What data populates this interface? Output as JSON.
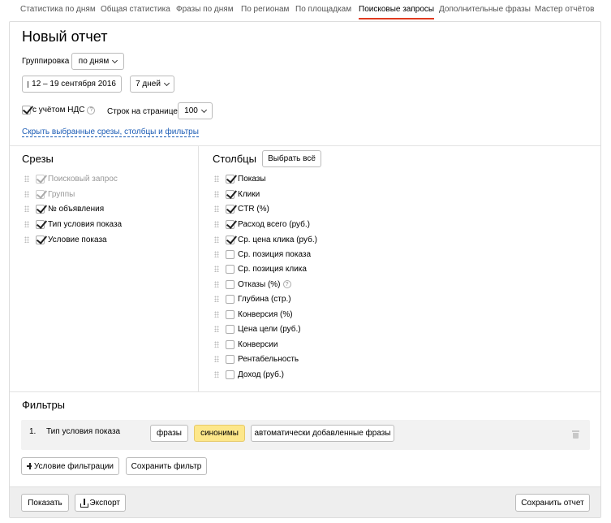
{
  "tabs": [
    {
      "label": "Статистика по дням",
      "active": false
    },
    {
      "label": "Общая статистика",
      "active": false
    },
    {
      "label": "Фразы по дням",
      "active": false
    },
    {
      "label": "По регионам",
      "active": false
    },
    {
      "label": "По площадкам",
      "active": false
    },
    {
      "label": "Поисковые запросы",
      "active": true
    },
    {
      "label": "Дополнительные фразы",
      "active": false
    },
    {
      "label": "Мастер отчётов",
      "active": false
    }
  ],
  "report": {
    "title": "Новый отчет",
    "grouping_label": "Группировка",
    "grouping_value": "по дням",
    "date_range": "12 – 19 сентября 2016",
    "period": "7 дней",
    "vat_label": "с учётом НДС",
    "vat_checked": true,
    "rows_label": "Строк на странице",
    "rows_value": "100",
    "hide_link": "Скрыть выбранные срезы, столбцы и фильтры"
  },
  "slices": {
    "title": "Срезы",
    "items": [
      {
        "label": "Поисковый запрос",
        "checked": true,
        "disabled": true
      },
      {
        "label": "Группы",
        "checked": true,
        "disabled": true
      },
      {
        "label": "№ объявления",
        "checked": true,
        "disabled": false
      },
      {
        "label": "Тип условия показа",
        "checked": true,
        "disabled": false
      },
      {
        "label": "Условие показа",
        "checked": true,
        "disabled": false
      }
    ]
  },
  "columns": {
    "title": "Столбцы",
    "select_all": "Выбрать всё",
    "items": [
      {
        "label": "Показы",
        "checked": true
      },
      {
        "label": "Клики",
        "checked": true
      },
      {
        "label": "CTR (%)",
        "checked": true
      },
      {
        "label": "Расход всего (руб.)",
        "checked": true
      },
      {
        "label": "Ср. цена клика (руб.)",
        "checked": true
      },
      {
        "label": "Ср. позиция показа",
        "checked": false
      },
      {
        "label": "Ср. позиция клика",
        "checked": false
      },
      {
        "label": "Отказы (%)",
        "checked": false
      },
      {
        "label": "Глубина (стр.)",
        "checked": false
      },
      {
        "label": "Конверсия (%)",
        "checked": false
      },
      {
        "label": "Цена цели (руб.)",
        "checked": false
      },
      {
        "label": "Конверсии",
        "checked": false
      },
      {
        "label": "Рентабельность",
        "checked": false
      },
      {
        "label": "Доход (руб.)",
        "checked": false
      }
    ]
  },
  "filters": {
    "title": "Фильтры",
    "rows": [
      {
        "index": "1.",
        "name": "Тип условия показа",
        "options": [
          "фразы",
          "синонимы",
          "автоматически добавленные фразы"
        ],
        "selected": "синонимы"
      }
    ],
    "add_condition": "Условие фильтрации",
    "save_filter": "Сохранить фильтр"
  },
  "footer": {
    "show": "Показать",
    "export": "Экспорт",
    "save_report": "Сохранить отчет"
  }
}
